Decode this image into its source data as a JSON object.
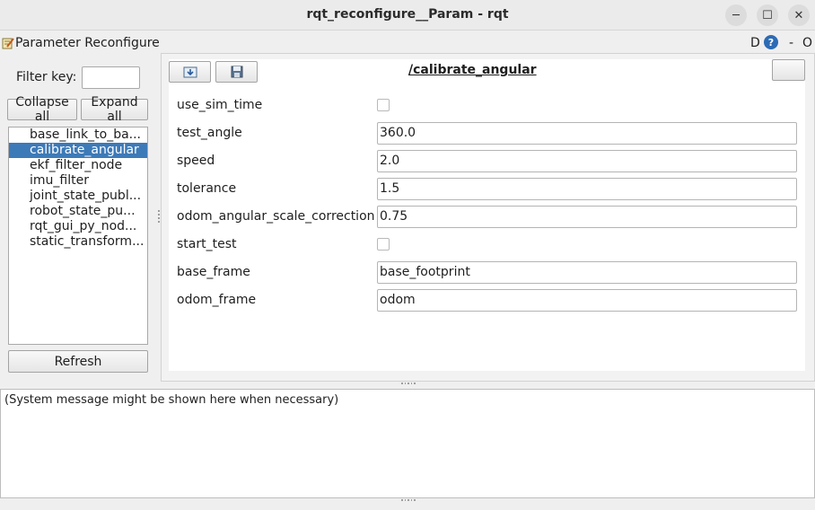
{
  "window": {
    "title": "rqt_reconfigure__Param - rqt",
    "minimize_glyph": "─",
    "maximize_glyph": "☐",
    "close_glyph": "✕"
  },
  "plugin": {
    "title": "Parameter Reconfigure",
    "icon": "notepad-edit-icon",
    "header_d": "D",
    "header_help": "?",
    "header_dash": "-",
    "header_o": "O"
  },
  "filter": {
    "label": "Filter key:",
    "value": ""
  },
  "tree_buttons": {
    "collapse_label": "Collapse all",
    "expand_label": "Expand all"
  },
  "nodes": [
    {
      "label": "base_link_to_ba..."
    },
    {
      "label": "calibrate_angular",
      "selected": true
    },
    {
      "label": "ekf_filter_node"
    },
    {
      "label": "imu_filter"
    },
    {
      "label": "joint_state_publ..."
    },
    {
      "label": "robot_state_pu..."
    },
    {
      "label": "rqt_gui_py_nod..."
    },
    {
      "label": "static_transform..."
    }
  ],
  "refresh_label": "Refresh",
  "editor": {
    "node_title": "/calibrate_angular",
    "load_icon": "load-file-icon",
    "save_icon": "save-disk-icon",
    "params": [
      {
        "name": "use_sim_time",
        "type": "bool",
        "value": false
      },
      {
        "name": "test_angle",
        "type": "text",
        "value": "360.0"
      },
      {
        "name": "speed",
        "type": "text",
        "value": "2.0"
      },
      {
        "name": "tolerance",
        "type": "text",
        "value": "1.5"
      },
      {
        "name": "odom_angular_scale_correction",
        "type": "text",
        "value": "0.75"
      },
      {
        "name": "start_test",
        "type": "bool",
        "value": false
      },
      {
        "name": "base_frame",
        "type": "text",
        "value": "base_footprint"
      },
      {
        "name": "odom_frame",
        "type": "text",
        "value": "odom"
      }
    ]
  },
  "message": "(System message might be shown here when necessary)"
}
